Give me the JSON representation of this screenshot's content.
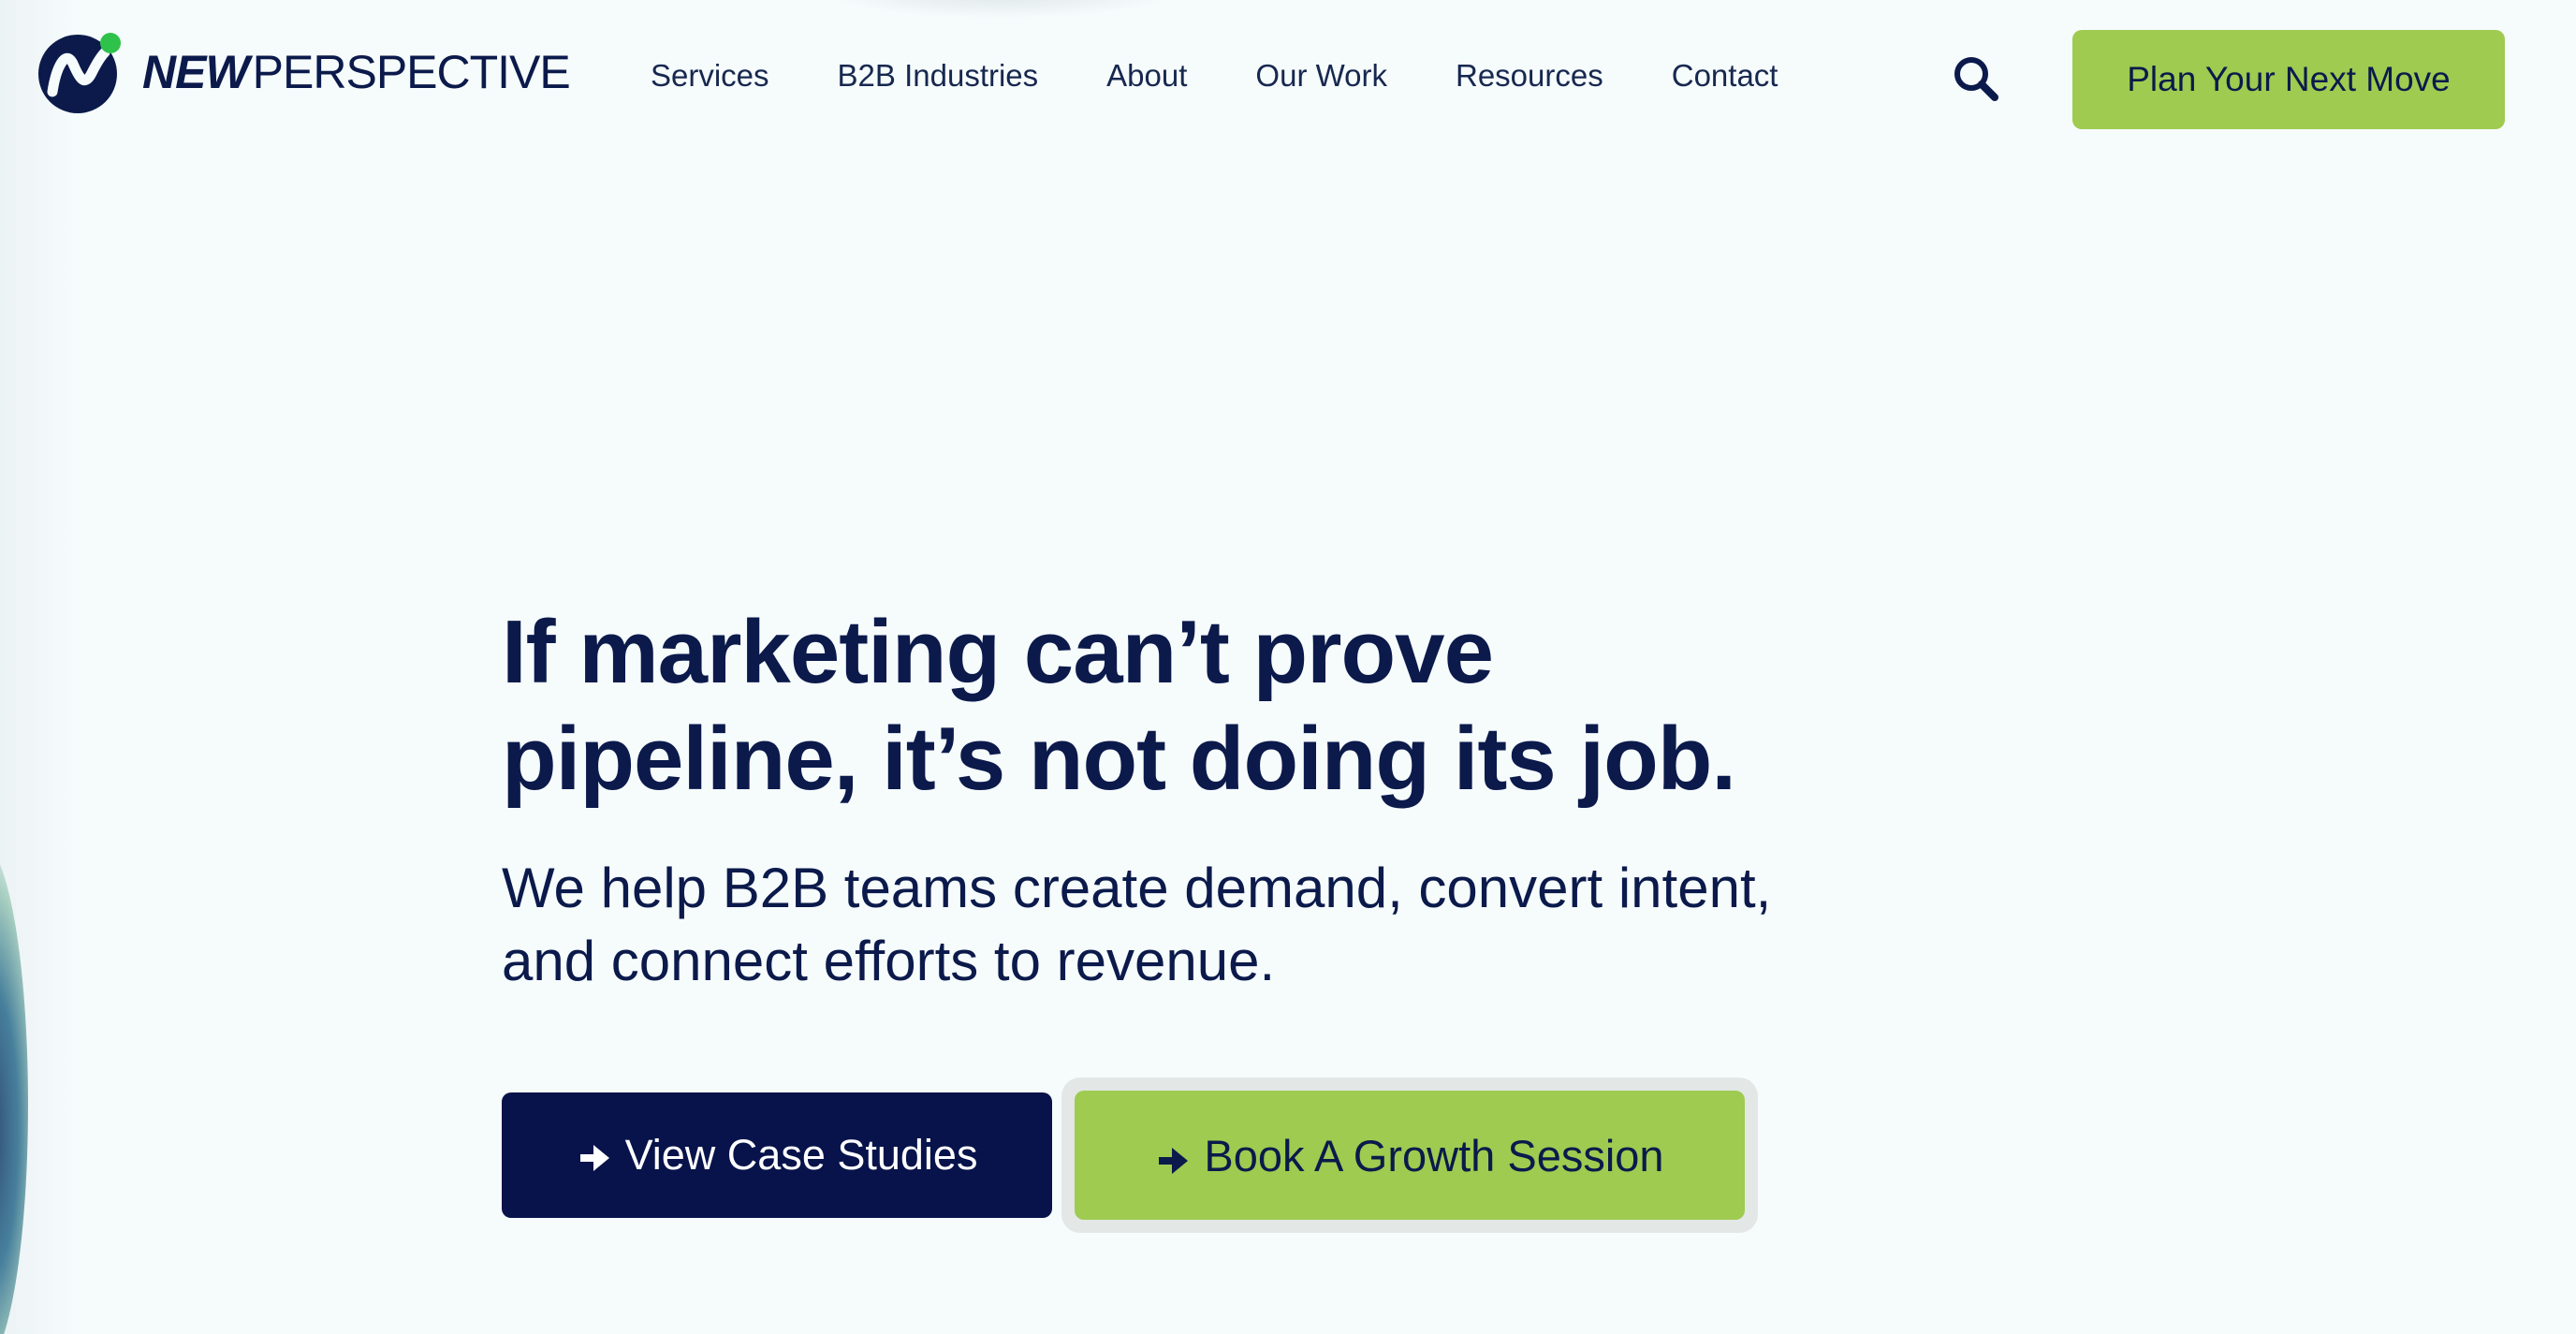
{
  "brand": {
    "name_bold": "NEW",
    "name_light": "PERSPECTIVE",
    "colors": {
      "navy": "#0b1a4b",
      "accent_green": "#9ecb50",
      "dot_green": "#2fc24a",
      "background": "#f6fbfc"
    }
  },
  "nav": {
    "items": [
      {
        "label": "Services"
      },
      {
        "label": "B2B Industries"
      },
      {
        "label": "About"
      },
      {
        "label": "Our Work"
      },
      {
        "label": "Resources"
      },
      {
        "label": "Contact"
      }
    ],
    "search_icon": "search-icon",
    "cta_label": "Plan Your Next Move"
  },
  "hero": {
    "headline_line1": "If marketing can’t prove",
    "headline_line2": "pipeline, it’s not doing its job.",
    "subhead_line1": "We help B2B teams create demand, convert intent,",
    "subhead_line2": "and connect efforts to revenue.",
    "primary_button": {
      "label": "View Case Studies",
      "icon": "arrow-right-icon"
    },
    "secondary_button": {
      "label": "Book A Growth Session",
      "icon": "arrow-right-icon"
    }
  }
}
